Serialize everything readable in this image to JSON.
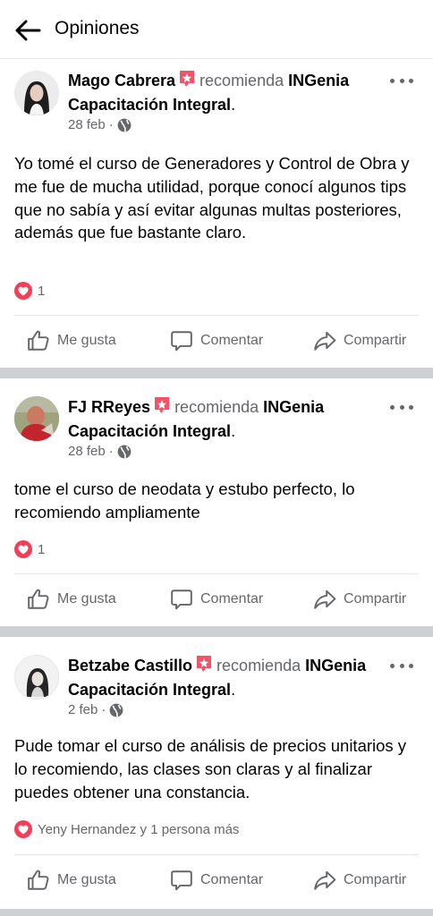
{
  "header": {
    "title": "Opiniones"
  },
  "labels": {
    "verb": "recomienda",
    "like": "Me gusta",
    "comment": "Comentar",
    "share": "Compartir",
    "dot": "·"
  },
  "reviews": [
    {
      "author": "Mago Cabrera",
      "page": "INGenia Capacitación Integral",
      "date": "28 feb",
      "text": "Yo tomé el curso de Generadores y Control de Obra y me fue de mucha utilidad, porque conocí algunos tips que no sabía y así evitar algunas multas posteriores, además que fue bastante claro.",
      "reactions": "1"
    },
    {
      "author": "FJ RReyes",
      "page": "INGenia Capacitación Integral",
      "date": "28 feb",
      "text": "tome el curso de neodata y estubo perfecto, lo recomiendo ampliamente",
      "reactions": "1"
    },
    {
      "author": "Betzabe Castillo",
      "page": "INGenia Capacitación Integral",
      "date": "2 feb",
      "text": "Pude tomar el curso de análisis de precios unitarios y lo recomiendo, las clases son claras y al finalizar puedes obtener una constancia.",
      "reactions": "Yeny Hernandez y 1 persona más"
    }
  ],
  "colors": {
    "reaction_heart": "#f33e58",
    "recommend_badge": "#f35369",
    "secondary_text": "#65676b",
    "separator": "#ced0d4"
  },
  "icons": [
    "back-arrow-icon",
    "recommend-badge-icon",
    "globe-icon",
    "more-icon",
    "heart-icon",
    "like-icon",
    "comment-icon",
    "share-icon"
  ]
}
